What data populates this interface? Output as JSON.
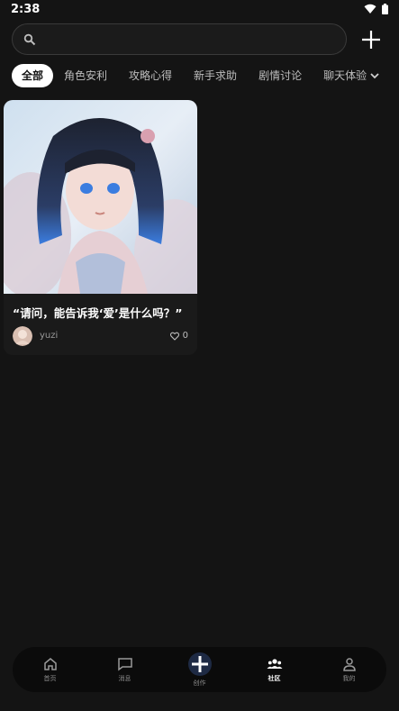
{
  "status_bar": {
    "time": "2:38"
  },
  "search": {
    "placeholder": ""
  },
  "tabs": [
    {
      "label": "全部",
      "active": true
    },
    {
      "label": "角色安利",
      "active": false
    },
    {
      "label": "攻略心得",
      "active": false
    },
    {
      "label": "新手求助",
      "active": false
    },
    {
      "label": "剧情讨论",
      "active": false
    },
    {
      "label": "聊天体验",
      "active": false
    }
  ],
  "post": {
    "title": "“请问，能告诉我‘爱’是什么吗？”",
    "author": "yuzi",
    "likes": "0"
  },
  "nav": {
    "home": "首页",
    "messages": "消息",
    "create": "创作",
    "community": "社区",
    "profile": "我的"
  },
  "colors": {
    "background": "#141414",
    "nav_background": "#0b0b0b",
    "active_tab": "#ffffff"
  }
}
